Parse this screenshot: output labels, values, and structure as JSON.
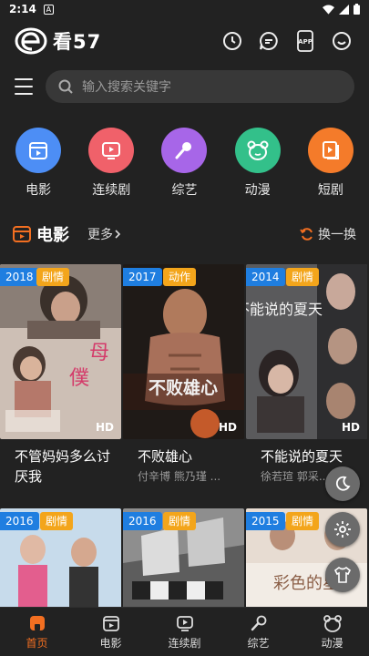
{
  "status_bar": {
    "time": "2:14",
    "notif_glyph": "A"
  },
  "header": {
    "logo_letter": "e",
    "app_name": "看57",
    "icons": [
      "history-icon",
      "message-icon",
      "app-icon",
      "profile-icon"
    ],
    "app_icon_label": "APP"
  },
  "search": {
    "placeholder": "输入搜索关键字"
  },
  "categories": [
    {
      "label": "电影",
      "color": "#4d8ef5",
      "icon": "film-icon"
    },
    {
      "label": "连续剧",
      "color": "#f0616a",
      "icon": "tv-icon"
    },
    {
      "label": "综艺",
      "color": "#a766e8",
      "icon": "microphone-icon"
    },
    {
      "label": "动漫",
      "color": "#33c08a",
      "icon": "bear-icon"
    },
    {
      "label": "短剧",
      "color": "#f47b2a",
      "icon": "short-drama-icon"
    }
  ],
  "section": {
    "title": "电影",
    "more": "更多",
    "refresh": "换一换",
    "accent": "#f36f21"
  },
  "movies_row1": [
    {
      "year": "2018",
      "genre": "剧情",
      "title": "不管妈妈多么讨厌我",
      "cast": "",
      "quality": "HD"
    },
    {
      "year": "2017",
      "genre": "动作",
      "title": "不败雄心",
      "cast": "付辛博 熊乃瑾 ...",
      "quality": "HD"
    },
    {
      "year": "2014",
      "genre": "剧情",
      "title": "不能说的夏天",
      "cast": "徐若瑄 郭采...",
      "quality": "HD"
    }
  ],
  "movies_row2": [
    {
      "year": "2016",
      "genre": "剧情"
    },
    {
      "year": "2016",
      "genre": "剧情"
    },
    {
      "year": "2015",
      "genre": "剧情"
    }
  ],
  "poster_texts": {
    "p1": "母",
    "p1b": "僕",
    "p2": "不败雄心",
    "p3": "不能说的夏天",
    "p6": "彩色的星"
  },
  "fabs": [
    "moon-icon",
    "settings-icon",
    "shirt-icon"
  ],
  "bottom_nav": [
    {
      "label": "首页",
      "icon": "home-icon",
      "active": true
    },
    {
      "label": "电影",
      "icon": "film-icon",
      "active": false
    },
    {
      "label": "连续剧",
      "icon": "tv-icon",
      "active": false
    },
    {
      "label": "综艺",
      "icon": "microphone-icon",
      "active": false
    },
    {
      "label": "动漫",
      "icon": "bear-icon",
      "active": false
    }
  ]
}
